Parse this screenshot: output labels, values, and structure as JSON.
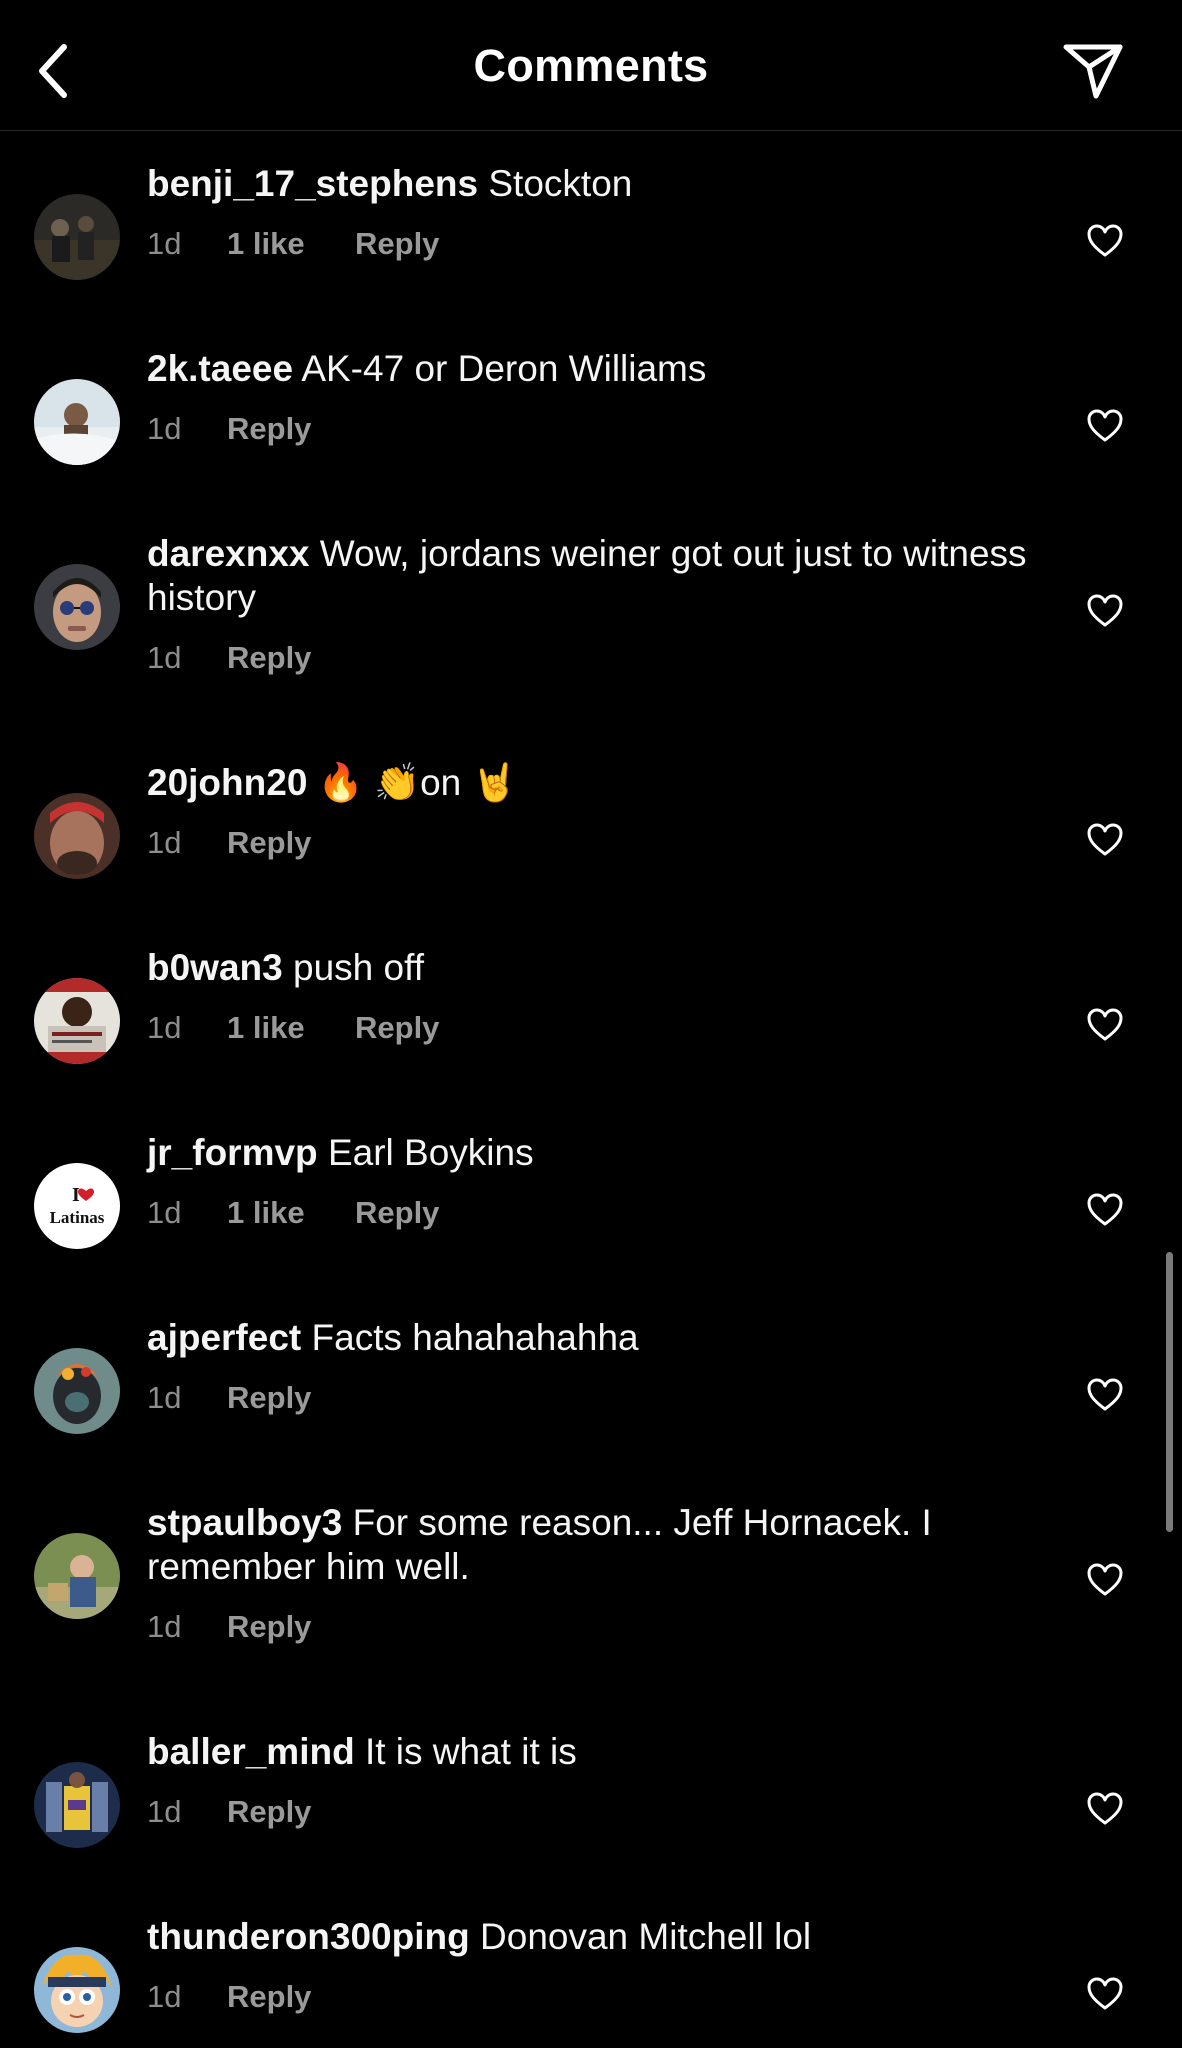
{
  "header": {
    "title": "Comments",
    "back_icon": "chevron-left-icon",
    "share_icon": "paper-plane-icon"
  },
  "comments": [
    {
      "username": "benji_17_stephens",
      "text": "Stockton",
      "time": "1d",
      "likes": "1 like",
      "reply": "Reply"
    },
    {
      "username": "2k.taeee",
      "text": "AK-47 or Deron Williams",
      "time": "1d",
      "likes": "",
      "reply": "Reply"
    },
    {
      "username": "darexnxx",
      "text": "Wow, jordans weiner got out just to witness  history",
      "time": "1d",
      "likes": "",
      "reply": "Reply"
    },
    {
      "username": "20john20",
      "text": "🔥 👏on 🤘",
      "time": "1d",
      "likes": "",
      "reply": "Reply"
    },
    {
      "username": "b0wan3",
      "text": "push off",
      "time": "1d",
      "likes": "1 like",
      "reply": "Reply"
    },
    {
      "username": "jr_formvp",
      "text": "Earl Boykins",
      "time": "1d",
      "likes": "1 like",
      "reply": "Reply"
    },
    {
      "username": "ajperfect",
      "text": "Facts hahahahahha",
      "time": "1d",
      "likes": "",
      "reply": "Reply"
    },
    {
      "username": "stpaulboy3",
      "text": "For some reason... Jeff Hornacek.  I remember him well.",
      "time": "1d",
      "likes": "",
      "reply": "Reply"
    },
    {
      "username": "baller_mind",
      "text": "It is what it is",
      "time": "1d",
      "likes": "",
      "reply": "Reply"
    },
    {
      "username": "thunderon300ping",
      "text": "Donovan Mitchell lol",
      "time": "1d",
      "likes": "",
      "reply": "Reply"
    }
  ],
  "avatars": {
    "jr_formvp_line1": "I",
    "jr_formvp_line2": "Latinas"
  },
  "colors": {
    "background": "#000000",
    "text": "#f5f5f5",
    "meta": "#9a9a9a",
    "divider": "#262626"
  }
}
